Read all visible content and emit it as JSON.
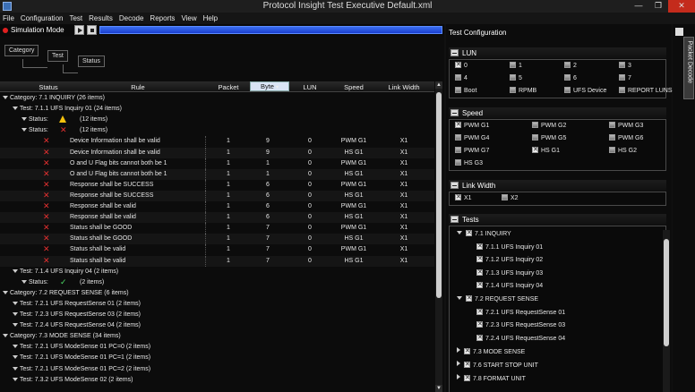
{
  "window": {
    "title": "Protocol Insight Test Executive    Default.xml",
    "minimize": "—",
    "restore": "❐",
    "close": "✕"
  },
  "menu": [
    "File",
    "Configuration",
    "Test",
    "Results",
    "Decode",
    "Reports",
    "View",
    "Help"
  ],
  "simulation": {
    "label": "Simulation Mode"
  },
  "grouping": {
    "chip1": "Category",
    "chip2": "Test",
    "chip3": "Status"
  },
  "columns": {
    "status": "Status",
    "rule": "Rule",
    "packet": "Packet",
    "byte": "Byte",
    "lun": "LUN",
    "speed": "Speed",
    "link_width": "Link Width"
  },
  "results": [
    {
      "type": "category",
      "text": "Category: 7.1 INQUIRY (26 items)"
    },
    {
      "type": "test",
      "text": "Test: 7.1.1 UFS Inquiry 01 (24 items)"
    },
    {
      "type": "status",
      "status": "warn",
      "label": "Status:",
      "count": "(12 items)"
    },
    {
      "type": "status",
      "status": "fail",
      "label": "Status:",
      "count": "(12 items)"
    },
    {
      "type": "rule",
      "rule": "Device Information shall be valid",
      "packet": "1",
      "byte": "9",
      "lun": "0",
      "speed": "PWM G1",
      "width": "X1"
    },
    {
      "type": "rule",
      "rule": "Device Information shall be valid",
      "packet": "1",
      "byte": "9",
      "lun": "0",
      "speed": "HS G1",
      "width": "X1"
    },
    {
      "type": "rule",
      "rule": "O and U Flag bits cannot both be 1",
      "packet": "1",
      "byte": "1",
      "lun": "0",
      "speed": "PWM G1",
      "width": "X1"
    },
    {
      "type": "rule",
      "rule": "O and U Flag bits cannot both be 1",
      "packet": "1",
      "byte": "1",
      "lun": "0",
      "speed": "HS G1",
      "width": "X1"
    },
    {
      "type": "rule",
      "rule": "Response shall be SUCCESS",
      "packet": "1",
      "byte": "6",
      "lun": "0",
      "speed": "PWM G1",
      "width": "X1"
    },
    {
      "type": "rule",
      "rule": "Response shall be SUCCESS",
      "packet": "1",
      "byte": "6",
      "lun": "0",
      "speed": "HS G1",
      "width": "X1"
    },
    {
      "type": "rule",
      "rule": "Response shall be valid",
      "packet": "1",
      "byte": "6",
      "lun": "0",
      "speed": "PWM G1",
      "width": "X1"
    },
    {
      "type": "rule",
      "rule": "Response shall be valid",
      "packet": "1",
      "byte": "6",
      "lun": "0",
      "speed": "HS G1",
      "width": "X1"
    },
    {
      "type": "rule",
      "rule": "Status shall be GOOD",
      "packet": "1",
      "byte": "7",
      "lun": "0",
      "speed": "PWM G1",
      "width": "X1"
    },
    {
      "type": "rule",
      "rule": "Status shall be GOOD",
      "packet": "1",
      "byte": "7",
      "lun": "0",
      "speed": "HS G1",
      "width": "X1"
    },
    {
      "type": "rule",
      "rule": "Status shall be valid",
      "packet": "1",
      "byte": "7",
      "lun": "0",
      "speed": "PWM G1",
      "width": "X1"
    },
    {
      "type": "rule",
      "rule": "Status shall be valid",
      "packet": "1",
      "byte": "7",
      "lun": "0",
      "speed": "HS G1",
      "width": "X1"
    },
    {
      "type": "test",
      "text": "Test: 7.1.4 UFS Inquiry 04 (2 items)"
    },
    {
      "type": "status",
      "status": "pass",
      "label": "Status:",
      "count": "(2 items)"
    },
    {
      "type": "category",
      "text": "Category: 7.2 REQUEST SENSE (6 items)"
    },
    {
      "type": "test",
      "text": "Test: 7.2.1 UFS RequestSense 01 (2 items)"
    },
    {
      "type": "test",
      "text": "Test: 7.2.3 UFS RequestSense 03 (2 items)"
    },
    {
      "type": "test",
      "text": "Test: 7.2.4 UFS RequestSense 04 (2 items)"
    },
    {
      "type": "category",
      "text": "Category: 7.3 MODE SENSE (34 items)"
    },
    {
      "type": "test",
      "text": "Test: 7.2.1 UFS ModeSense 01 PC=0 (2 items)"
    },
    {
      "type": "test",
      "text": "Test: 7.2.1 UFS ModeSense 01 PC=1 (2 items)"
    },
    {
      "type": "test",
      "text": "Test: 7.2.1 UFS ModeSense 01 PC=2 (2 items)"
    },
    {
      "type": "test",
      "text": "Test: 7.3.2 UFS ModeSense 02 (2 items)"
    }
  ],
  "config": {
    "title": "Test Configuration",
    "lun": {
      "title": "LUN",
      "options": [
        {
          "label": "0",
          "checked": true
        },
        {
          "label": "1",
          "checked": false
        },
        {
          "label": "2",
          "checked": false
        },
        {
          "label": "3",
          "checked": false
        },
        {
          "label": "4",
          "checked": false
        },
        {
          "label": "5",
          "checked": false
        },
        {
          "label": "6",
          "checked": false
        },
        {
          "label": "7",
          "checked": false
        },
        {
          "label": "Boot",
          "checked": false
        },
        {
          "label": "RPMB",
          "checked": false
        },
        {
          "label": "UFS Device",
          "checked": false
        },
        {
          "label": "REPORT LUNS",
          "checked": false
        }
      ]
    },
    "speed": {
      "title": "Speed",
      "options": [
        {
          "label": "PWM G1",
          "checked": true
        },
        {
          "label": "PWM G2",
          "checked": false
        },
        {
          "label": "PWM G3",
          "checked": false
        },
        {
          "label": "PWM G4",
          "checked": false
        },
        {
          "label": "PWM G5",
          "checked": false
        },
        {
          "label": "PWM G6",
          "checked": false
        },
        {
          "label": "PWM G7",
          "checked": false
        },
        {
          "label": "HS G1",
          "checked": true
        },
        {
          "label": "HS G2",
          "checked": false
        },
        {
          "label": "HS G3",
          "checked": false
        }
      ]
    },
    "link_width": {
      "title": "Link Width",
      "options": [
        {
          "label": "X1",
          "checked": true
        },
        {
          "label": "X2",
          "checked": false
        }
      ]
    },
    "tests": {
      "title": "Tests",
      "tree": [
        {
          "level": 1,
          "toggle": "down",
          "label": "7.1 INQUIRY"
        },
        {
          "level": 2,
          "label": "7.1.1 UFS Inquiry 01"
        },
        {
          "level": 2,
          "label": "7.1.2 UFS Inquiry 02"
        },
        {
          "level": 2,
          "label": "7.1.3 UFS Inquiry 03"
        },
        {
          "level": 2,
          "label": "7.1.4 UFS Inquiry 04"
        },
        {
          "level": 1,
          "toggle": "down",
          "label": "7.2 REQUEST SENSE"
        },
        {
          "level": 2,
          "label": "7.2.1 UFS RequestSense 01"
        },
        {
          "level": 2,
          "label": "7.2.3 UFS RequestSense 03"
        },
        {
          "level": 2,
          "label": "7.2.4 UFS RequestSense 04"
        },
        {
          "level": 1,
          "toggle": "right",
          "label": "7.3 MODE SENSE"
        },
        {
          "level": 1,
          "toggle": "right",
          "label": "7.6  START STOP UNIT"
        },
        {
          "level": 1,
          "toggle": "right",
          "label": "7.8  FORMAT UNIT"
        }
      ]
    }
  },
  "side_tab": {
    "label": "Packet Decode"
  }
}
